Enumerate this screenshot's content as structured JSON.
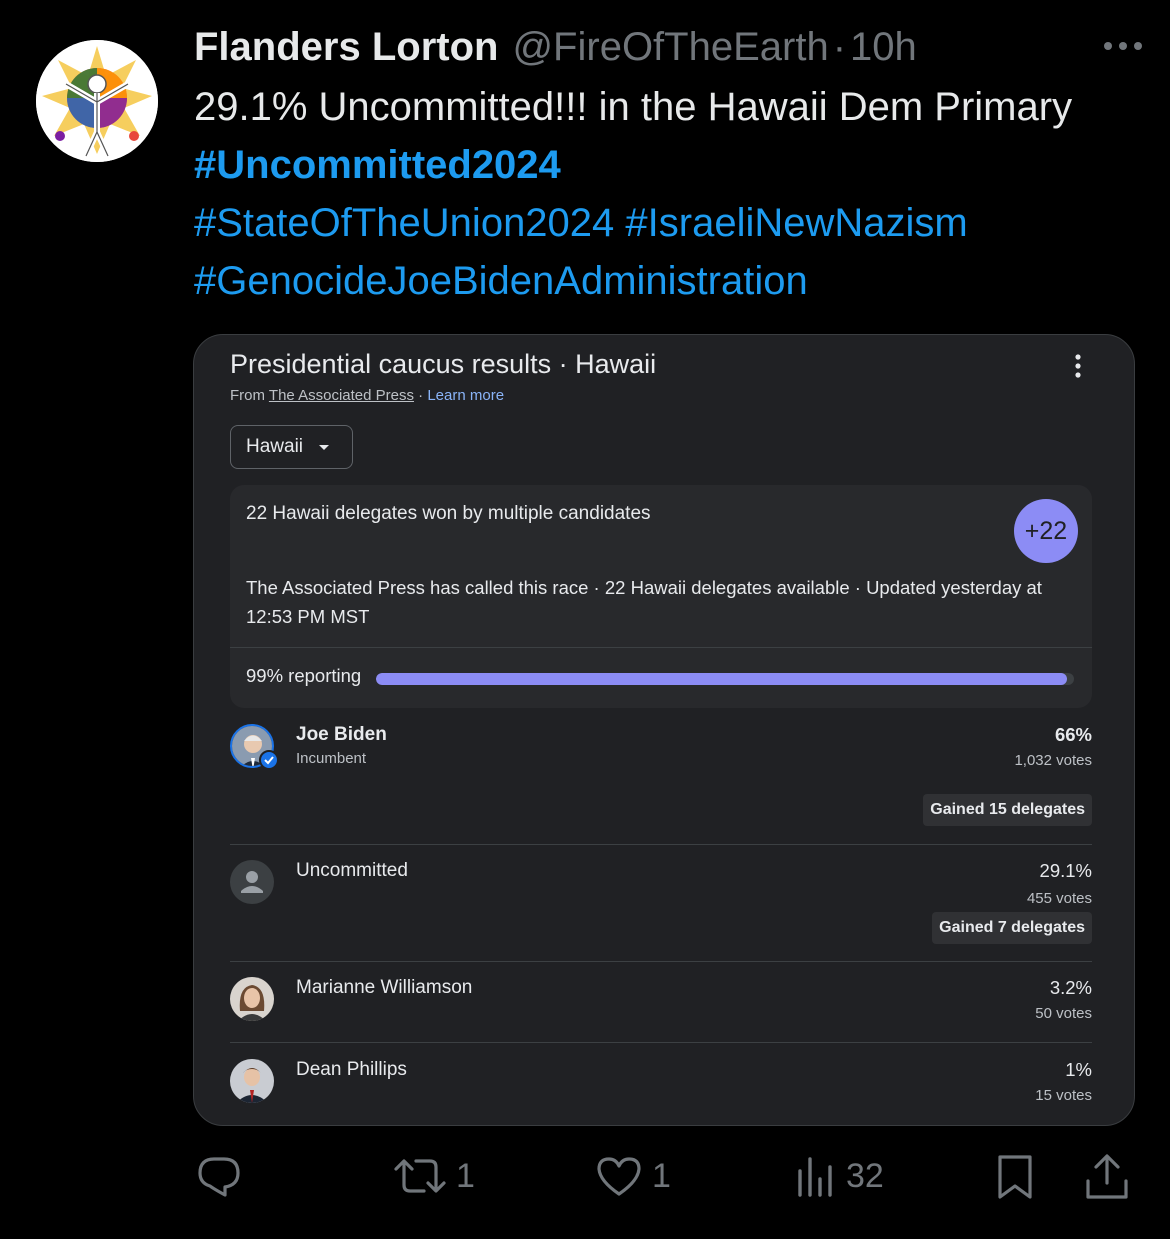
{
  "tweet": {
    "author_name": "Flanders Lorton",
    "handle": "@FireOfTheEarth",
    "separator": "·",
    "time": "10h",
    "text_main": "29.1% Uncommitted!!! in the Hawaii Dem Primary ",
    "hashtags": [
      "#Uncommitted2024",
      "#StateOfTheUnion2024",
      "#IsraeliNewNazism",
      "#GenocideJoeBidenAdministration"
    ]
  },
  "card": {
    "title": "Presidential caucus results · Hawaii",
    "source_prefix": "From ",
    "source_name": "The Associated Press",
    "source_sep": " · ",
    "learn_more": "Learn more",
    "region_select": "Hawaii",
    "summary_heading": "22 Hawaii delegates won by multiple candidates",
    "delegate_badge": "+22",
    "summary_detail": "The Associated Press has called this race · 22 Hawaii delegates available · Updated yesterday at 12:53 PM MST",
    "reporting_label": "99% reporting",
    "reporting_fraction": 0.99,
    "accent_color": "#8c8cf5",
    "candidates": [
      {
        "name": "Joe Biden",
        "subtitle": "Incumbent",
        "pct": "66%",
        "votes": "1,032 votes",
        "gained": "Gained 15 delegates"
      },
      {
        "name": "Uncommitted",
        "pct": "29.1%",
        "votes": "455 votes",
        "gained": "Gained 7 delegates"
      },
      {
        "name": "Marianne Williamson",
        "pct": "3.2%",
        "votes": "50 votes"
      },
      {
        "name": "Dean Phillips",
        "pct": "1%",
        "votes": "15 votes"
      }
    ]
  },
  "actions": {
    "reply_icon": "reply-icon",
    "retweet_count": "1",
    "like_count": "1",
    "views_count": "32",
    "link_color": "#1d9bf0"
  }
}
